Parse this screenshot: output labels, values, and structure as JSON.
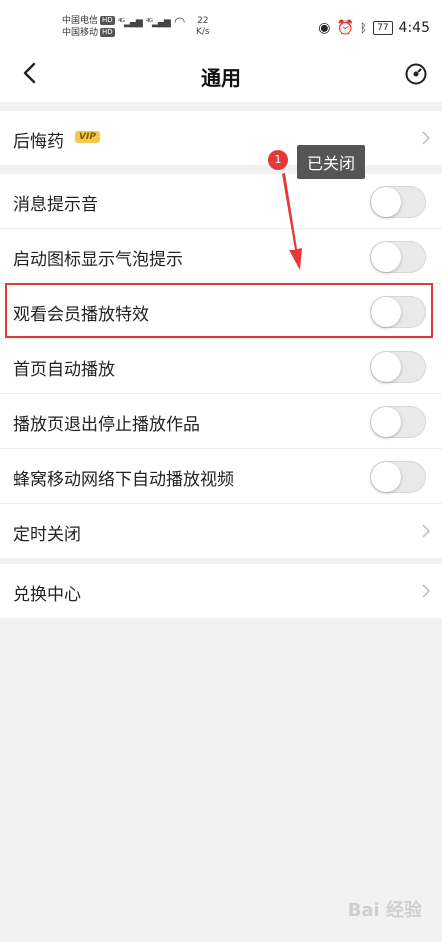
{
  "status": {
    "carrier1": "中国电信",
    "carrier2": "中国移动",
    "hd": "HD",
    "speed_value": "22",
    "speed_unit": "K/s",
    "battery": "77",
    "time": "4:45"
  },
  "nav": {
    "title": "通用"
  },
  "groups": {
    "g1": [
      {
        "label": "后悔药",
        "vip": "VIP"
      }
    ],
    "g2": [
      {
        "label": "消息提示音",
        "on": false
      },
      {
        "label": "启动图标显示气泡提示",
        "on": false
      },
      {
        "label": "观看会员播放特效",
        "on": false
      },
      {
        "label": "首页自动播放",
        "on": false
      },
      {
        "label": "播放页退出停止播放作品",
        "on": false
      },
      {
        "label": "蜂窝移动网络下自动播放视频",
        "on": false
      },
      {
        "label": "定时关闭"
      }
    ],
    "g3": [
      {
        "label": "兑换中心"
      }
    ]
  },
  "annotation": {
    "step": "1",
    "text": "已关闭",
    "highlight_color": "#e03a3a"
  },
  "watermark": "Bai 经验"
}
